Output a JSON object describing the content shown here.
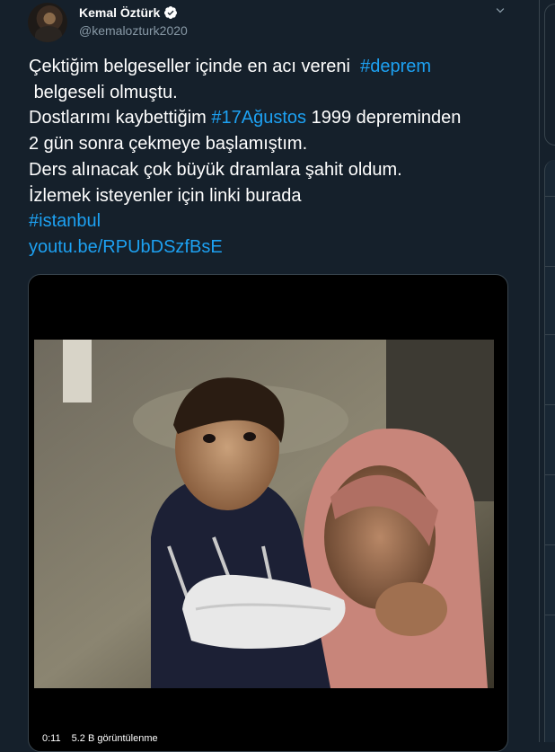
{
  "tweet": {
    "author_name": "Kemal Öztürk",
    "author_handle": "@kemalozturk2020",
    "body": [
      {
        "t": "Çektiğim belgeseller içinde en acı vereni  ",
        "link": false
      },
      {
        "t": "#deprem",
        "link": true
      },
      {
        "t": "\n belgeseli olmuştu.\nDostlarımı kaybettiğim ",
        "link": false
      },
      {
        "t": "#17Ağustos",
        "link": true
      },
      {
        "t": " 1999 depreminden\n2 gün sonra çekmeye başlamıştım.\nDers alınacak çok büyük dramlara şahit oldum.\nİzlemek isteyenler için linki burada\n",
        "link": false
      },
      {
        "t": "#istanbul",
        "link": true
      },
      {
        "t": "\n",
        "link": false
      },
      {
        "t": "youtu.be/RPUbDSzfBsE",
        "link": true
      }
    ]
  },
  "video": {
    "duration": "0:11",
    "views": "5.2 B görüntülenme"
  },
  "icons": {
    "verified": "verified-badge-icon",
    "caret": "chevron-down-icon"
  },
  "colors": {
    "background": "#15202b",
    "link": "#1da1f2",
    "muted": "#8899a6",
    "border": "#38444d"
  }
}
